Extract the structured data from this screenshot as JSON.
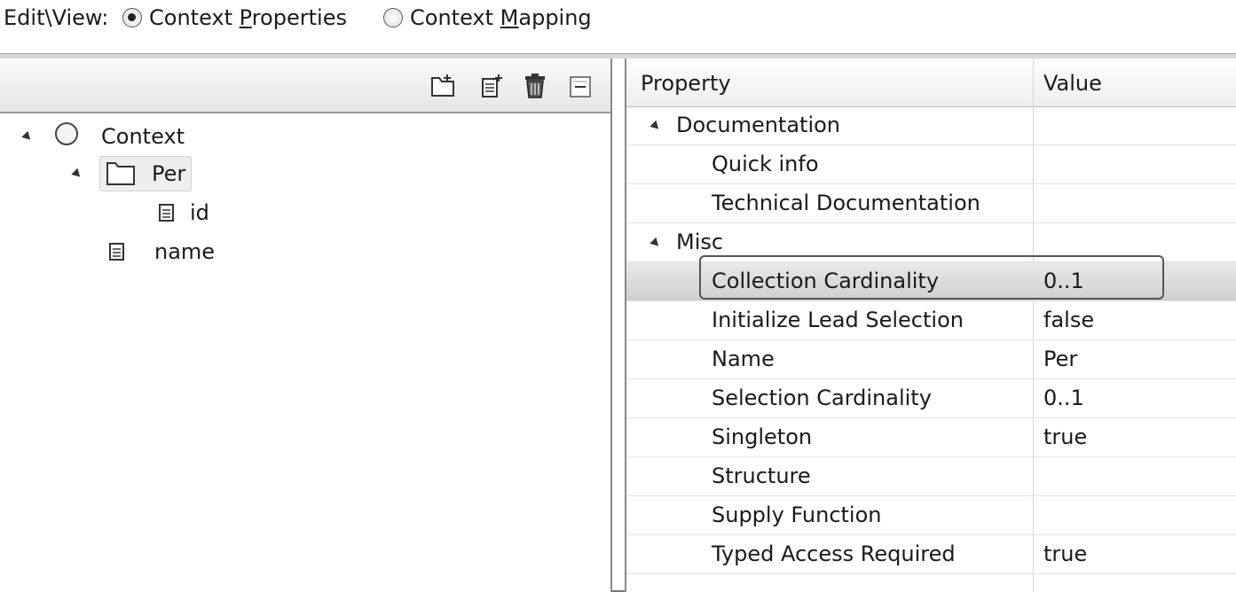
{
  "topbar": {
    "label": "Edit\\View:",
    "options": [
      {
        "label_pre": "Context ",
        "mnemonic": "P",
        "label_post": "roperties",
        "checked": true
      },
      {
        "label_pre": "Context ",
        "mnemonic": "M",
        "label_post": "apping",
        "checked": false
      }
    ]
  },
  "toolbar": {
    "icons": [
      "new-node-icon",
      "new-attribute-icon",
      "delete-icon",
      "collapse-icon"
    ]
  },
  "tree": {
    "root": {
      "label": "Context",
      "icon": "circle-icon"
    },
    "node": {
      "label": "Per",
      "icon": "folder-icon"
    },
    "child_attr": {
      "label": "id",
      "icon": "attribute-icon"
    },
    "root_attr": {
      "label": "name",
      "icon": "attribute-icon"
    }
  },
  "properties": {
    "header": {
      "property": "Property",
      "value": "Value"
    },
    "categories": {
      "documentation": "Documentation",
      "misc": "Misc"
    },
    "rows": [
      {
        "name": "Quick info",
        "value": ""
      },
      {
        "name": "Technical Documentation",
        "value": ""
      },
      {
        "name": "Collection Cardinality",
        "value": "0..1"
      },
      {
        "name": "Initialize Lead Selection",
        "value": "false"
      },
      {
        "name": "Name",
        "value": "Per"
      },
      {
        "name": "Selection Cardinality",
        "value": "0..1"
      },
      {
        "name": "Singleton",
        "value": "true"
      },
      {
        "name": "Structure",
        "value": ""
      },
      {
        "name": "Supply Function",
        "value": ""
      },
      {
        "name": "Typed Access Required",
        "value": "true"
      }
    ]
  }
}
